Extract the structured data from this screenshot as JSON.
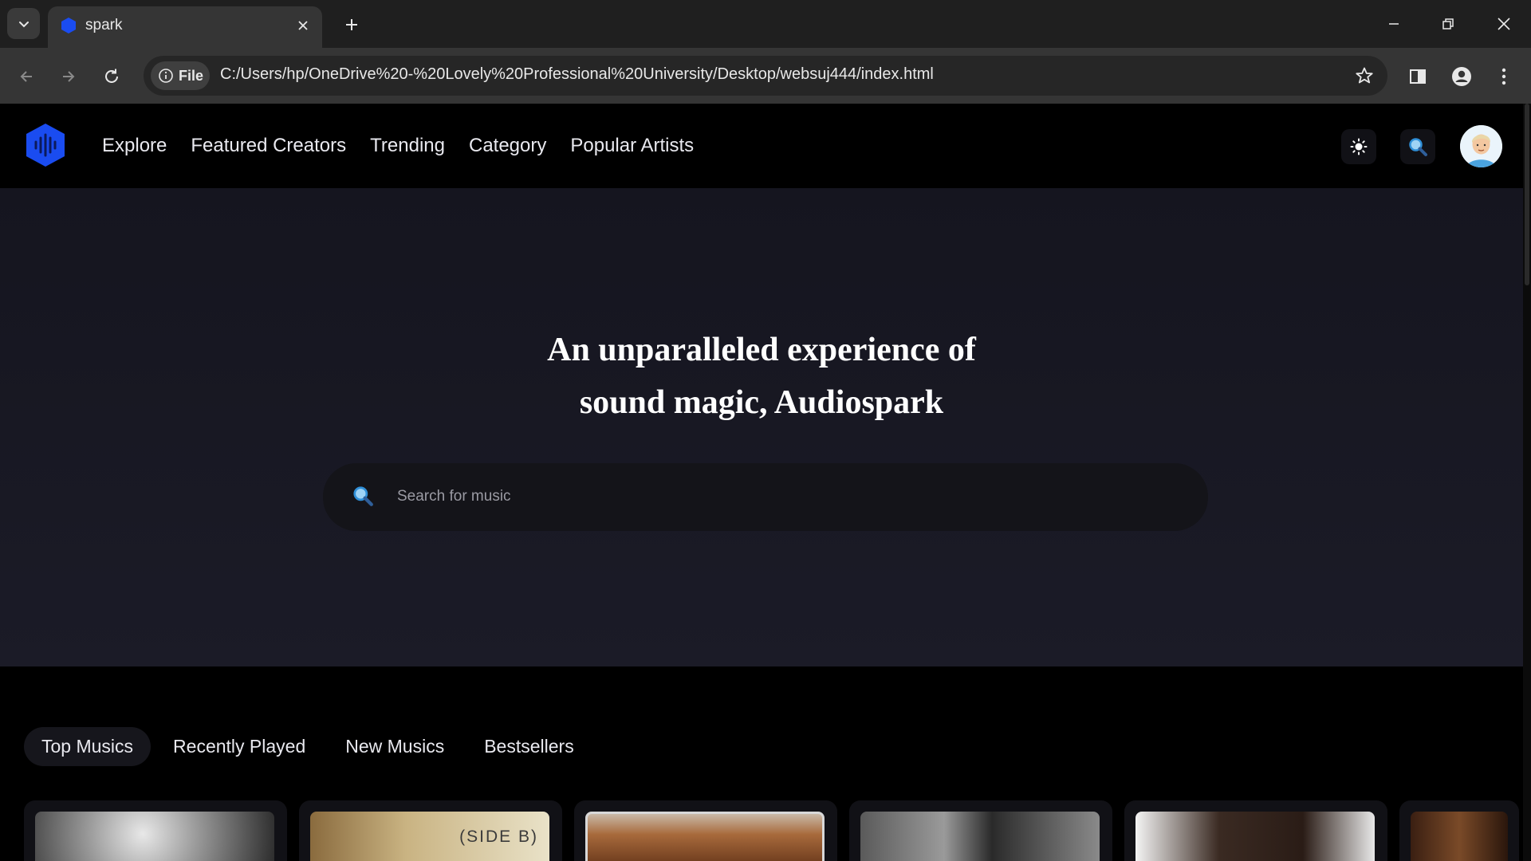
{
  "browser": {
    "tab_title": "spark",
    "site_chip_label": "File",
    "url": "C:/Users/hp/OneDrive%20-%20Lovely%20Professional%20University/Desktop/websuj444/index.html"
  },
  "site": {
    "brand_color": "#1a4cf0",
    "nav_links": [
      "Explore",
      "Featured Creators",
      "Trending",
      "Category",
      "Popular Artists"
    ]
  },
  "hero": {
    "title_line1": "An unparalleled experience of",
    "title_line2": "sound magic, Audiospark",
    "search_placeholder": "Search for music"
  },
  "music_tabs": {
    "items": [
      "Top Musics",
      "Recently Played",
      "New Musics",
      "Bestsellers"
    ],
    "active": "Top Musics"
  },
  "cards": {
    "side_b_label": "(SIDE B)"
  }
}
